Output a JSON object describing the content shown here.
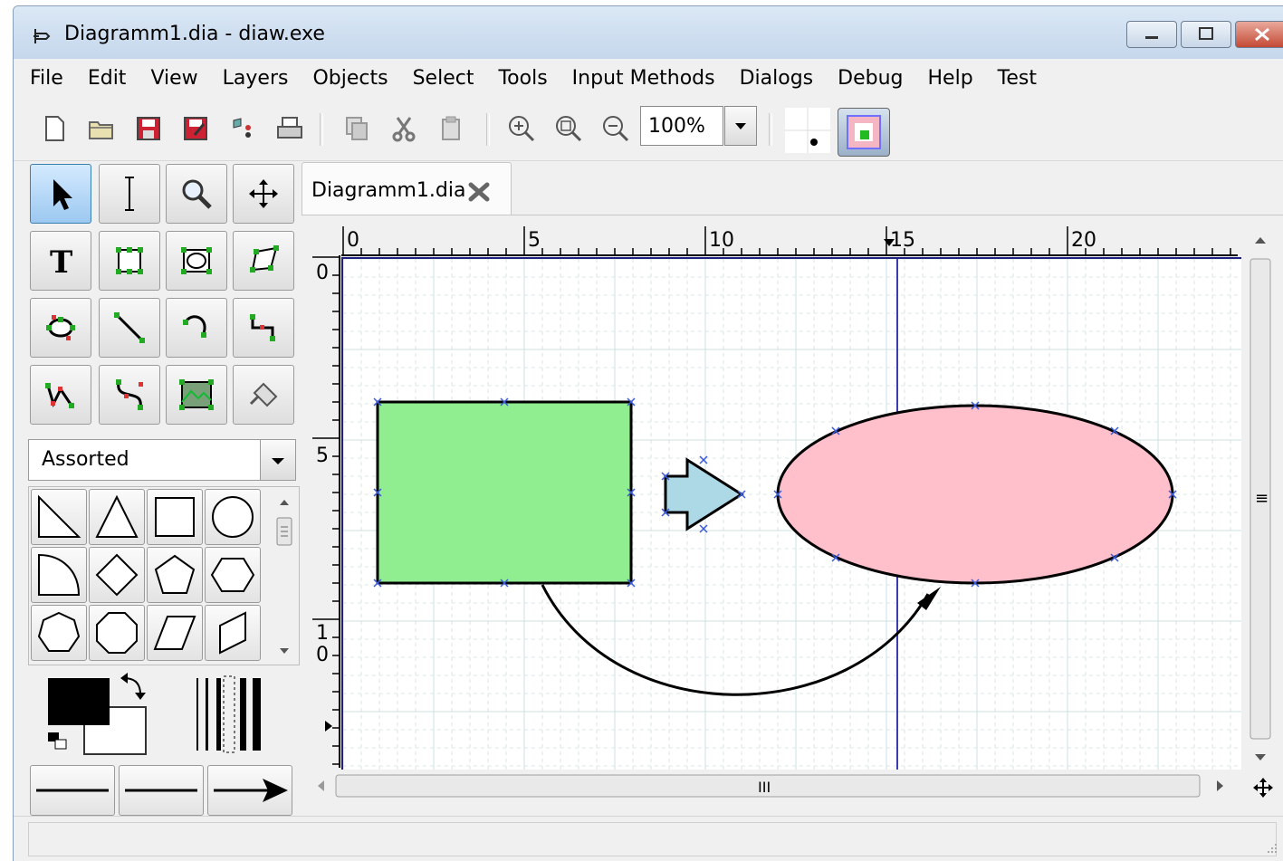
{
  "window": {
    "title": "Diagramm1.dia - diaw.exe"
  },
  "menu": [
    "File",
    "Edit",
    "View",
    "Layers",
    "Objects",
    "Select",
    "Tools",
    "Input Methods",
    "Dialogs",
    "Debug",
    "Help",
    "Test"
  ],
  "toolbar": {
    "zoom_value": "100%"
  },
  "tab": {
    "label": "Diagramm1.dia"
  },
  "sheet": {
    "selected": "Assorted"
  },
  "rulers": {
    "horizontal_labels": [
      "0",
      "5",
      "10",
      "15",
      "20"
    ],
    "vertical_labels": [
      "0",
      "5",
      "1",
      "0"
    ]
  },
  "hscroll": {
    "grip": "III"
  },
  "vscroll": {
    "grip": "≡"
  },
  "diagram": {
    "rectangle_fill": "#90ee90",
    "ellipse_fill": "#ffc0cb",
    "arrow_fill": "#add8e6",
    "guide_color": "#3b3bb3",
    "grid_color": "#cfe0e0"
  },
  "colors": {
    "foreground": "#000000",
    "background": "#ffffff"
  }
}
